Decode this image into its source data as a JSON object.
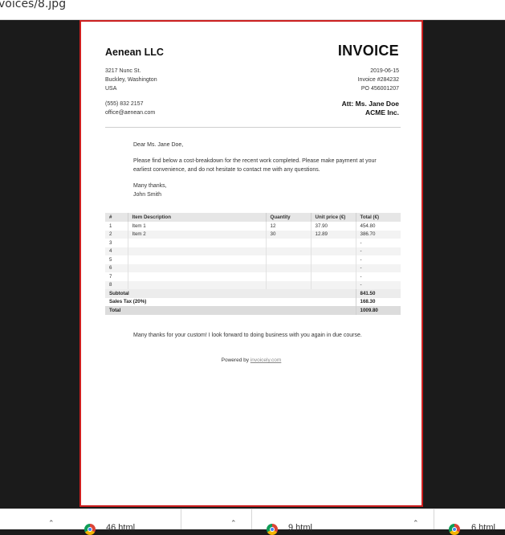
{
  "browser": {
    "path": "voices/8.jpg",
    "downloads": [
      {
        "name": "46.html"
      },
      {
        "name": "9.html"
      },
      {
        "name": "6.html"
      }
    ]
  },
  "invoice": {
    "company": "Aenean LLC",
    "title": "INVOICE",
    "address": [
      "3217 Nunc St.",
      "Buckley, Washington",
      "USA"
    ],
    "contact": [
      "(555) 832 2157",
      "office@aenean.com"
    ],
    "meta": [
      "2019-06-15",
      "Invoice #284232",
      "PO 456001207"
    ],
    "attention": [
      "Att: Ms. Jane Doe",
      "ACME Inc."
    ],
    "letter": {
      "greeting": "Dear Ms. Jane Doe,",
      "body": "Please find below a cost-breakdown for the recent work completed. Please make payment at your earliest convenience, and do not hesitate to contact me with any questions.",
      "signoff": "Many thanks,",
      "signature": "John Smith"
    },
    "table": {
      "headers": [
        "#",
        "Item Description",
        "Quantity",
        "Unit price (€)",
        "Total (€)"
      ],
      "rows": [
        [
          "1",
          "Item 1",
          "12",
          "37.90",
          "454.80"
        ],
        [
          "2",
          "Item 2",
          "30",
          "12.89",
          "386.70"
        ],
        [
          "3",
          "",
          "",
          "",
          "-"
        ],
        [
          "4",
          "",
          "",
          "",
          "-"
        ],
        [
          "5",
          "",
          "",
          "",
          "-"
        ],
        [
          "6",
          "",
          "",
          "",
          "-"
        ],
        [
          "7",
          "",
          "",
          "",
          "-"
        ],
        [
          "8",
          "",
          "",
          "",
          "-"
        ]
      ],
      "subtotal_label": "Subtotal",
      "subtotal": "841.50",
      "tax_label": "Sales Tax (20%)",
      "tax": "168.30",
      "total_label": "Total",
      "total": "1009.80"
    },
    "footer": "Many thanks for your custom! I look forward to doing business with you again in due course.",
    "powered_prefix": "Powered by",
    "powered_link": "invoicely.com"
  }
}
